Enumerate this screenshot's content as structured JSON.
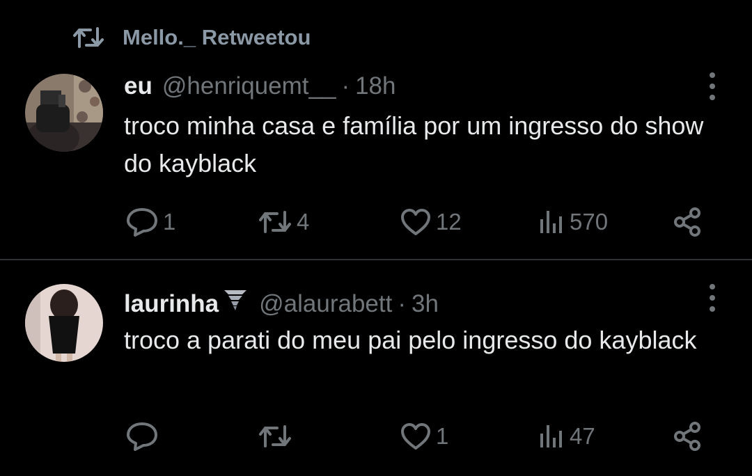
{
  "retweet": {
    "label": "Mello._ Retweetou"
  },
  "tweets": [
    {
      "name": "eu",
      "handle": "@henriquemt__",
      "dot": "·",
      "time": "18h",
      "text": "troco minha casa e família por um ingresso do show do kayblack",
      "replies": "1",
      "retweets": "4",
      "likes": "12",
      "views": "570"
    },
    {
      "name": "laurinha",
      "name_emoji": "tornado-emoji",
      "handle": "@alaurabett",
      "dot": "·",
      "time": "3h",
      "text": "troco a parati do meu pai pelo ingresso do kayblack",
      "replies": "",
      "retweets": "",
      "likes": "1",
      "views": "47"
    }
  ],
  "colors": {
    "background": "#000000",
    "primary_text": "#e7e9ea",
    "secondary_text": "#71767b",
    "divider": "#2f3336"
  }
}
